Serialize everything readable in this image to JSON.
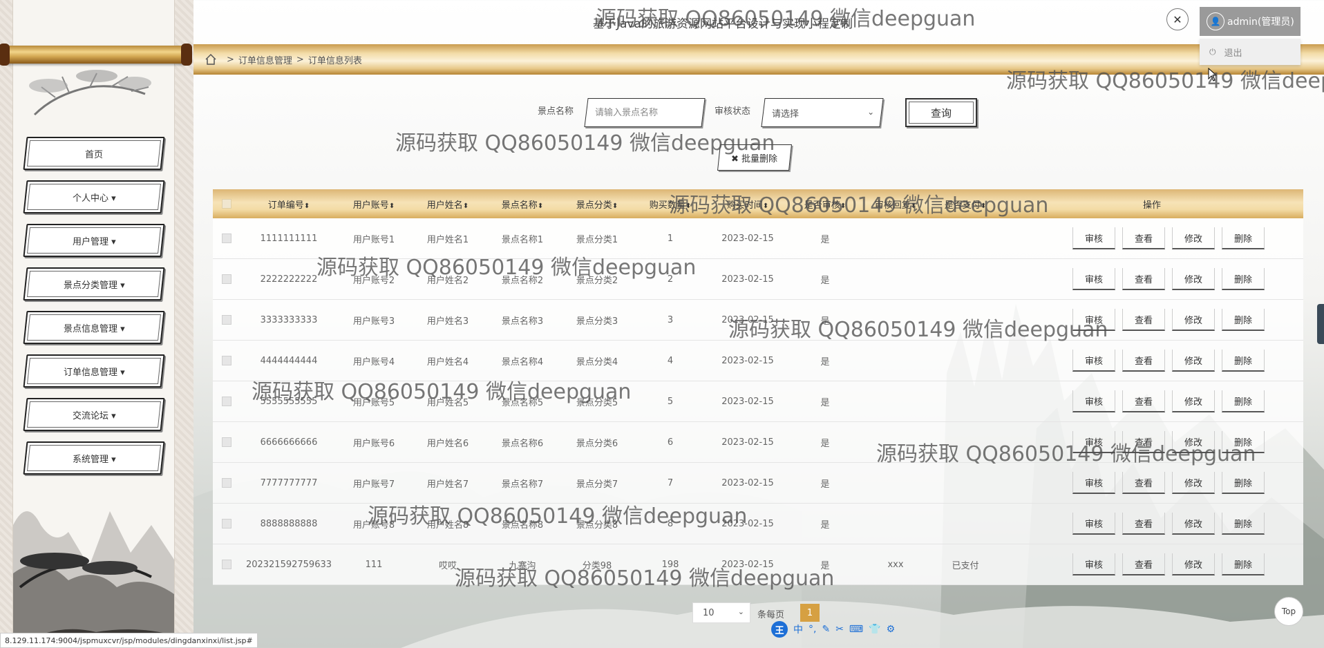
{
  "app": {
    "title": "基于Java的旅游资源网站平台设计与实现小程定制"
  },
  "user": {
    "name": "admin(管理员)",
    "logout_label": "退出"
  },
  "breadcrumb": {
    "items": [
      "订单信息管理",
      "订单信息列表"
    ],
    "separator": ">"
  },
  "sidebar": {
    "items": [
      {
        "label": "首页"
      },
      {
        "label": "个人中心 ▾"
      },
      {
        "label": "用户管理 ▾"
      },
      {
        "label": "景点分类管理 ▾"
      },
      {
        "label": "景点信息管理 ▾"
      },
      {
        "label": "订单信息管理 ▾"
      },
      {
        "label": "交流论坛 ▾"
      },
      {
        "label": "系统管理 ▾"
      }
    ]
  },
  "search": {
    "name_label": "景点名称",
    "name_placeholder": "请输入景点名称",
    "status_label": "审核状态",
    "status_value": "请选择",
    "query_label": "查询",
    "batch_delete_label": "✖ 批量删除"
  },
  "table": {
    "headers": [
      "订单编号",
      "用户账号",
      "用户姓名",
      "景点名称",
      "景点分类",
      "购买数量",
      "购买时间",
      "是否审核",
      "审核回复",
      "是否支付",
      "操作"
    ],
    "sort_glyph": "⬍",
    "rows": [
      [
        "1111111111",
        "用户账号1",
        "用户姓名1",
        "景点名称1",
        "景点分类1",
        "1",
        "2023-02-15",
        "是",
        "",
        ""
      ],
      [
        "2222222222",
        "用户账号2",
        "用户姓名2",
        "景点名称2",
        "景点分类2",
        "2",
        "2023-02-15",
        "是",
        "",
        ""
      ],
      [
        "3333333333",
        "用户账号3",
        "用户姓名3",
        "景点名称3",
        "景点分类3",
        "3",
        "2023-02-15",
        "是",
        "",
        ""
      ],
      [
        "4444444444",
        "用户账号4",
        "用户姓名4",
        "景点名称4",
        "景点分类4",
        "4",
        "2023-02-15",
        "是",
        "",
        ""
      ],
      [
        "5555555555",
        "用户账号5",
        "用户姓名5",
        "景点名称5",
        "景点分类5",
        "5",
        "2023-02-15",
        "是",
        "",
        ""
      ],
      [
        "6666666666",
        "用户账号6",
        "用户姓名6",
        "景点名称6",
        "景点分类6",
        "6",
        "2023-02-15",
        "是",
        "",
        ""
      ],
      [
        "7777777777",
        "用户账号7",
        "用户姓名7",
        "景点名称7",
        "景点分类7",
        "7",
        "2023-02-15",
        "是",
        "",
        ""
      ],
      [
        "8888888888",
        "用户账号8",
        "用户姓名8",
        "景点名称8",
        "景点分类8",
        "8",
        "2023-02-15",
        "是",
        "",
        ""
      ],
      [
        "202321592759633",
        "111",
        "哎哎",
        "九寨沟",
        "分类98",
        "198",
        "2023-02-15",
        "是",
        "xxx",
        "已支付"
      ]
    ],
    "actions": [
      "审核",
      "查看",
      "修改",
      "删除"
    ]
  },
  "pagination": {
    "page_size": "10",
    "page_size_label": "条每页",
    "current_page": "1"
  },
  "top_button_label": "Top",
  "status_url": "8.129.11.174:9004/jspmuxcvr/jsp/modules/dingdanxinxi/list.jsp#",
  "ime": {
    "logo": "王",
    "lang": "中",
    "glyphs": [
      "°,",
      "✎",
      "✂",
      "⌨",
      "👕",
      "⚙"
    ]
  },
  "watermark": "源码获取 QQ86050149 微信deepguan",
  "colors": {
    "accent_gold": "#d6a042",
    "header_gold": "#f3dba5"
  },
  "icons": {
    "close": "close-icon",
    "user": "user-icon",
    "logout": "power-icon",
    "home": "home-icon"
  }
}
